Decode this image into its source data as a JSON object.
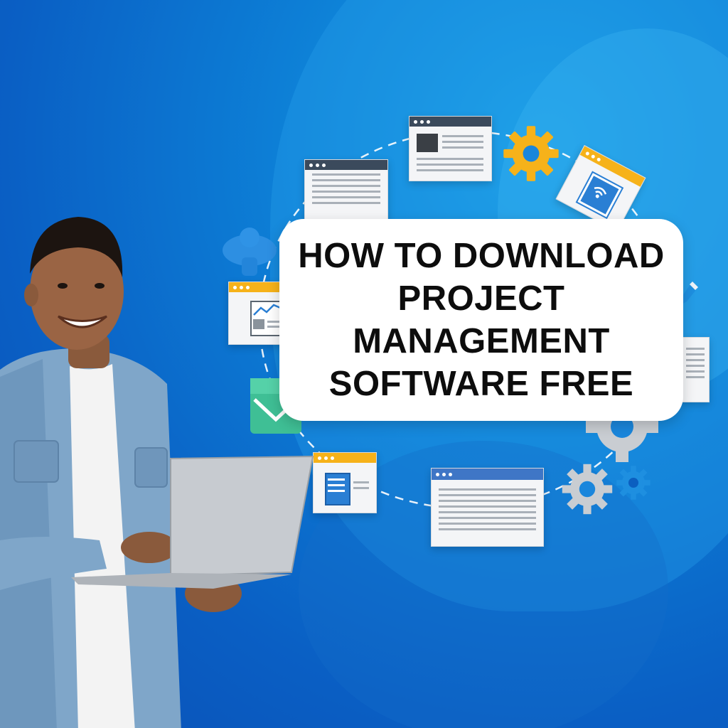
{
  "headline": {
    "lines": [
      "HOW TO DOWNLOAD",
      "PROJECT",
      "MANAGEMENT",
      "SOFTWARE FREE"
    ]
  },
  "colors": {
    "background": "#0a5fc4",
    "accent_yellow": "#f6b21a",
    "window_bar_dark": "#3b4a5c",
    "window_bar_blue": "#3f76c6",
    "email_green": "#3fbf95",
    "gear_gray": "#c9cdd2",
    "gear_blue": "#1e8fe0"
  },
  "icons": [
    "browser-window-icon",
    "document-window-icon",
    "gear-icon",
    "wifi-window-icon",
    "person-icon",
    "chart-window-icon",
    "email-icon",
    "form-window-icon",
    "text-window-icon",
    "gear-icon",
    "pencil-icon"
  ],
  "illustration": {
    "subject": "person-holding-laptop"
  }
}
